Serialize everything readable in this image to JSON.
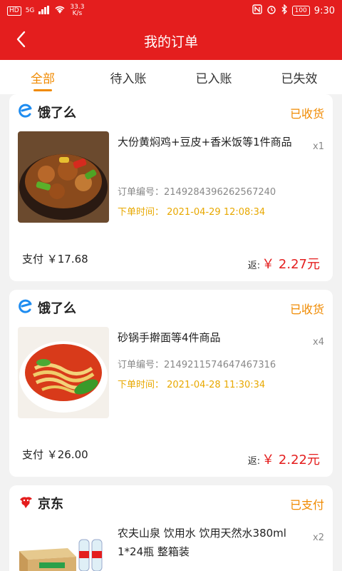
{
  "statusbar": {
    "network_badge": "HD",
    "network_type": "5G",
    "speed_value": "33.3",
    "speed_unit": "K/s",
    "battery": "100",
    "time": "9:30"
  },
  "header": {
    "title": "我的订单"
  },
  "tabs": [
    {
      "label": "全部",
      "active": true
    },
    {
      "label": "待入账",
      "active": false
    },
    {
      "label": "已入账",
      "active": false
    },
    {
      "label": "已失效",
      "active": false
    }
  ],
  "orders": [
    {
      "platform": "饿了么",
      "platform_icon": "eleme-icon",
      "status": "已收货",
      "title": "大份黄焖鸡+豆皮+香米饭等1件商品",
      "quantity": "x1",
      "order_no": "订单编号：2149284396262567240",
      "order_time": "下单时间：  2021-04-29 12:08:34",
      "pay_amount": "支付 ￥17.68",
      "rebate_label": "返:",
      "rebate_amount": "￥ 2.27元"
    },
    {
      "platform": "饿了么",
      "platform_icon": "eleme-icon",
      "status": "已收货",
      "title": "砂锅手擀面等4件商品",
      "quantity": "x4",
      "order_no": "订单编号：2149211574647467316",
      "order_time": "下单时间：  2021-04-28 11:30:34",
      "pay_amount": "支付 ￥26.00",
      "rebate_label": "返:",
      "rebate_amount": "￥ 2.22元"
    },
    {
      "platform": "京东",
      "platform_icon": "jd-icon",
      "status": "已支付",
      "title": "农夫山泉 饮用水 饮用天然水380ml 1*24瓶 整箱装",
      "quantity": "x2"
    }
  ],
  "colors": {
    "brand_red": "#e41e1e",
    "accent_orange": "#f08a00",
    "time_yellow": "#e8a800",
    "eleme_blue": "#1e8cf0"
  }
}
